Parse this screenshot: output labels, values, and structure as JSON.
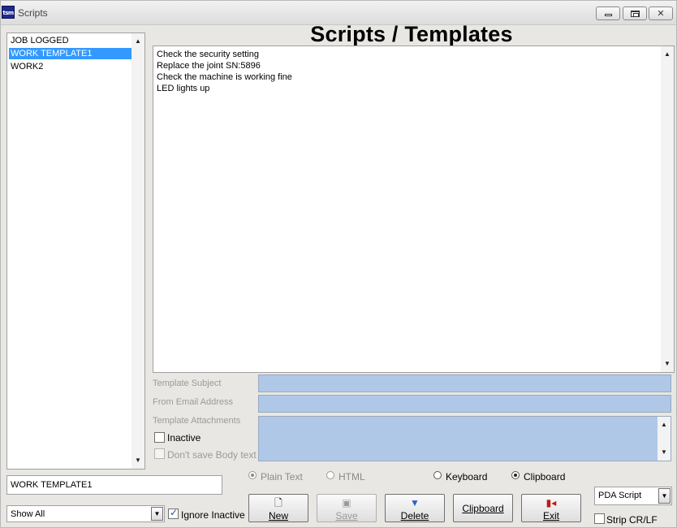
{
  "window": {
    "title": "Scripts",
    "icon_text": "tsm"
  },
  "heading": "Scripts / Templates",
  "template_list": {
    "items": [
      {
        "label": "JOB LOGGED",
        "selected": false
      },
      {
        "label": "WORK TEMPLATE1",
        "selected": true
      },
      {
        "label": "WORK2",
        "selected": false
      }
    ]
  },
  "body_text": [
    "Check the security setting",
    "Replace the joint SN:5896",
    "Check the machine is working fine",
    "LED lights up"
  ],
  "fields": {
    "template_subject_label": "Template Subject",
    "from_email_label": "From Email Address",
    "attachments_label": "Template Attachments"
  },
  "checks": {
    "inactive": "Inactive",
    "dont_save_body": "Don't save Body text",
    "ignore_inactive": "Ignore Inactive",
    "strip_crlf": "Strip CR/LF"
  },
  "radios": {
    "plain_text": "Plain Text",
    "html": "HTML",
    "keyboard": "Keyboard",
    "clipboard": "Clipboard"
  },
  "template_name": "WORK TEMPLATE1",
  "filter_combo": "Show All",
  "script_type_combo": "PDA Script",
  "buttons": {
    "new": "New",
    "save": "Save",
    "delete": "Delete",
    "clipboard": "Clipboard",
    "exit": "Exit"
  },
  "colors": {
    "selection": "#3399ff",
    "field_blue": "#b0c8e8",
    "disabled_text": "#9a9a9a"
  }
}
